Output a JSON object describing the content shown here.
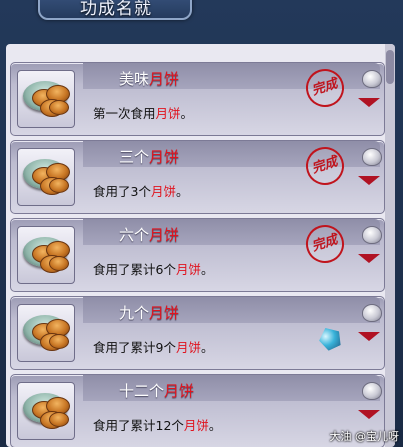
{
  "window": {
    "title": "功成名就"
  },
  "achievements": [
    {
      "name_prefix": "美味",
      "name_red": "月饼",
      "name_suffix": "",
      "desc_prefix": "第一次食用",
      "desc_red": "月饼",
      "desc_suffix": "。",
      "stamp": "完成",
      "completed": true
    },
    {
      "name_prefix": "三个",
      "name_red": "月饼",
      "name_suffix": "",
      "desc_prefix": "食用了3个",
      "desc_red": "月饼",
      "desc_suffix": "。",
      "stamp": "完成",
      "completed": true
    },
    {
      "name_prefix": "六个",
      "name_red": "月饼",
      "name_suffix": "",
      "desc_prefix": "食用了累计6个",
      "desc_red": "月饼",
      "desc_suffix": "。",
      "stamp": "完成",
      "completed": true
    },
    {
      "name_prefix": "九个",
      "name_red": "月饼",
      "name_suffix": "",
      "desc_prefix": "食用了累计9个",
      "desc_red": "月饼",
      "desc_suffix": "。",
      "stamp": "",
      "completed": false
    },
    {
      "name_prefix": "十二个",
      "name_red": "月饼",
      "name_suffix": "",
      "desc_prefix": "食用了累计12个",
      "desc_red": "月饼",
      "desc_suffix": "。",
      "stamp": "",
      "completed": false
    }
  ],
  "watermark": "大油 @宝儿呀"
}
